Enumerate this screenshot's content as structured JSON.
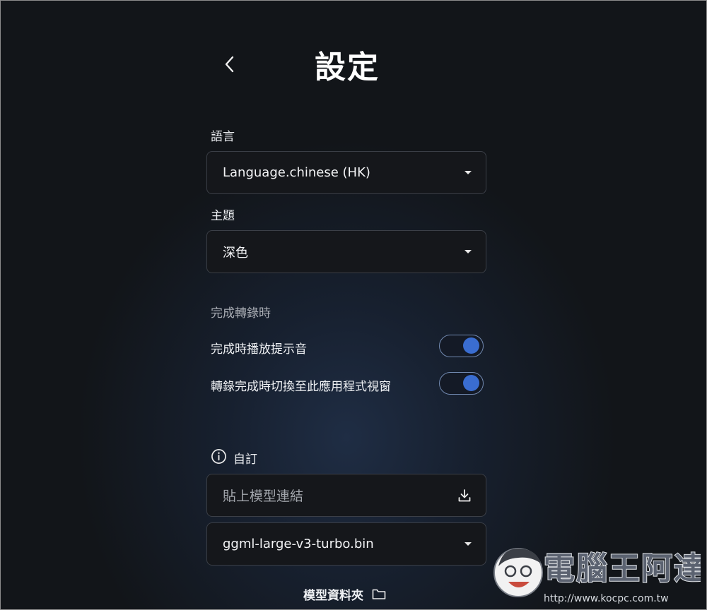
{
  "header": {
    "title": "設定"
  },
  "language": {
    "label": "語言",
    "value": "Language.chinese (HK)"
  },
  "theme": {
    "label": "主題",
    "value": "深色"
  },
  "completion": {
    "section_label": "完成轉錄時",
    "toggles": [
      {
        "label": "完成時播放提示音",
        "on": true
      },
      {
        "label": "轉錄完成時切換至此應用程式視窗",
        "on": true
      }
    ]
  },
  "custom": {
    "label": "自訂",
    "url_placeholder": "貼上模型連結",
    "model_value": "ggml-large-v3-turbo.bin",
    "folder_label": "模型資料夾"
  },
  "watermark": {
    "text": "電腦王阿達",
    "url": "http://www.kocpc.com.tw"
  },
  "colors": {
    "accent": "#3a6dd0",
    "toggle_border": "#7189b0"
  }
}
